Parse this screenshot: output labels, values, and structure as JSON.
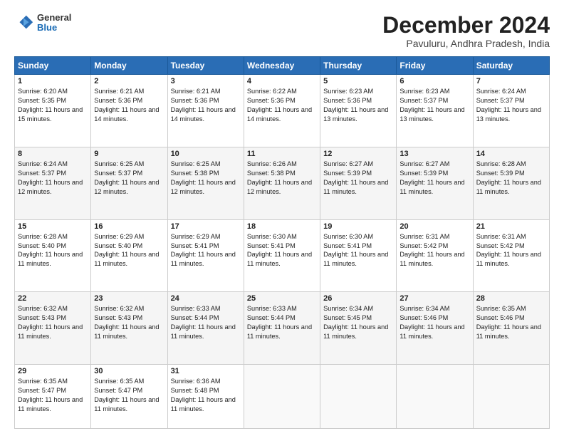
{
  "header": {
    "logo": {
      "general": "General",
      "blue": "Blue"
    },
    "title": "December 2024",
    "location": "Pavuluru, Andhra Pradesh, India"
  },
  "calendar": {
    "weekdays": [
      "Sunday",
      "Monday",
      "Tuesday",
      "Wednesday",
      "Thursday",
      "Friday",
      "Saturday"
    ],
    "weeks": [
      [
        {
          "day": "1",
          "sunrise": "6:20 AM",
          "sunset": "5:35 PM",
          "daylight": "11 hours and 15 minutes."
        },
        {
          "day": "2",
          "sunrise": "6:21 AM",
          "sunset": "5:36 PM",
          "daylight": "11 hours and 14 minutes."
        },
        {
          "day": "3",
          "sunrise": "6:21 AM",
          "sunset": "5:36 PM",
          "daylight": "11 hours and 14 minutes."
        },
        {
          "day": "4",
          "sunrise": "6:22 AM",
          "sunset": "5:36 PM",
          "daylight": "11 hours and 14 minutes."
        },
        {
          "day": "5",
          "sunrise": "6:23 AM",
          "sunset": "5:36 PM",
          "daylight": "11 hours and 13 minutes."
        },
        {
          "day": "6",
          "sunrise": "6:23 AM",
          "sunset": "5:37 PM",
          "daylight": "11 hours and 13 minutes."
        },
        {
          "day": "7",
          "sunrise": "6:24 AM",
          "sunset": "5:37 PM",
          "daylight": "11 hours and 13 minutes."
        }
      ],
      [
        {
          "day": "8",
          "sunrise": "6:24 AM",
          "sunset": "5:37 PM",
          "daylight": "11 hours and 12 minutes."
        },
        {
          "day": "9",
          "sunrise": "6:25 AM",
          "sunset": "5:37 PM",
          "daylight": "11 hours and 12 minutes."
        },
        {
          "day": "10",
          "sunrise": "6:25 AM",
          "sunset": "5:38 PM",
          "daylight": "11 hours and 12 minutes."
        },
        {
          "day": "11",
          "sunrise": "6:26 AM",
          "sunset": "5:38 PM",
          "daylight": "11 hours and 12 minutes."
        },
        {
          "day": "12",
          "sunrise": "6:27 AM",
          "sunset": "5:39 PM",
          "daylight": "11 hours and 11 minutes."
        },
        {
          "day": "13",
          "sunrise": "6:27 AM",
          "sunset": "5:39 PM",
          "daylight": "11 hours and 11 minutes."
        },
        {
          "day": "14",
          "sunrise": "6:28 AM",
          "sunset": "5:39 PM",
          "daylight": "11 hours and 11 minutes."
        }
      ],
      [
        {
          "day": "15",
          "sunrise": "6:28 AM",
          "sunset": "5:40 PM",
          "daylight": "11 hours and 11 minutes."
        },
        {
          "day": "16",
          "sunrise": "6:29 AM",
          "sunset": "5:40 PM",
          "daylight": "11 hours and 11 minutes."
        },
        {
          "day": "17",
          "sunrise": "6:29 AM",
          "sunset": "5:41 PM",
          "daylight": "11 hours and 11 minutes."
        },
        {
          "day": "18",
          "sunrise": "6:30 AM",
          "sunset": "5:41 PM",
          "daylight": "11 hours and 11 minutes."
        },
        {
          "day": "19",
          "sunrise": "6:30 AM",
          "sunset": "5:41 PM",
          "daylight": "11 hours and 11 minutes."
        },
        {
          "day": "20",
          "sunrise": "6:31 AM",
          "sunset": "5:42 PM",
          "daylight": "11 hours and 11 minutes."
        },
        {
          "day": "21",
          "sunrise": "6:31 AM",
          "sunset": "5:42 PM",
          "daylight": "11 hours and 11 minutes."
        }
      ],
      [
        {
          "day": "22",
          "sunrise": "6:32 AM",
          "sunset": "5:43 PM",
          "daylight": "11 hours and 11 minutes."
        },
        {
          "day": "23",
          "sunrise": "6:32 AM",
          "sunset": "5:43 PM",
          "daylight": "11 hours and 11 minutes."
        },
        {
          "day": "24",
          "sunrise": "6:33 AM",
          "sunset": "5:44 PM",
          "daylight": "11 hours and 11 minutes."
        },
        {
          "day": "25",
          "sunrise": "6:33 AM",
          "sunset": "5:44 PM",
          "daylight": "11 hours and 11 minutes."
        },
        {
          "day": "26",
          "sunrise": "6:34 AM",
          "sunset": "5:45 PM",
          "daylight": "11 hours and 11 minutes."
        },
        {
          "day": "27",
          "sunrise": "6:34 AM",
          "sunset": "5:46 PM",
          "daylight": "11 hours and 11 minutes."
        },
        {
          "day": "28",
          "sunrise": "6:35 AM",
          "sunset": "5:46 PM",
          "daylight": "11 hours and 11 minutes."
        }
      ],
      [
        {
          "day": "29",
          "sunrise": "6:35 AM",
          "sunset": "5:47 PM",
          "daylight": "11 hours and 11 minutes."
        },
        {
          "day": "30",
          "sunrise": "6:35 AM",
          "sunset": "5:47 PM",
          "daylight": "11 hours and 11 minutes."
        },
        {
          "day": "31",
          "sunrise": "6:36 AM",
          "sunset": "5:48 PM",
          "daylight": "11 hours and 11 minutes."
        },
        null,
        null,
        null,
        null
      ]
    ]
  }
}
